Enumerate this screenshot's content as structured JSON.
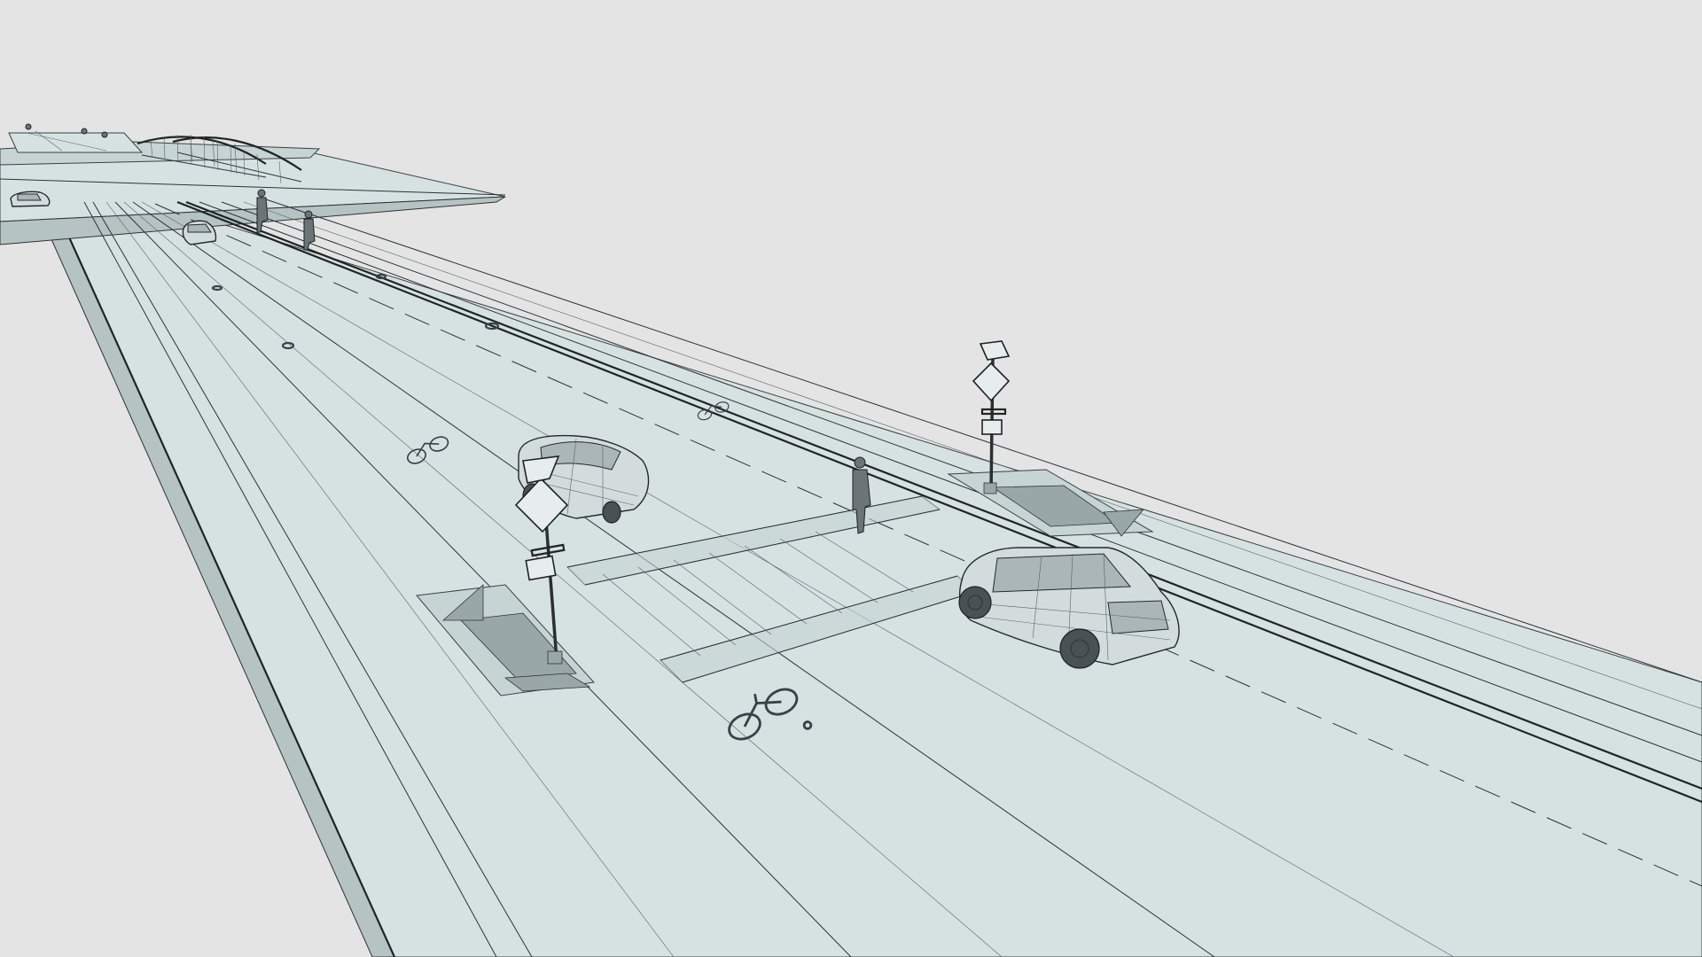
{
  "scene": {
    "background_color": "#e4e4e4",
    "ground_color": "#d6e2e2",
    "line_color": "#2d3236",
    "objects": {
      "cars": [
        "sedan-near-crosswalk",
        "suv-foreground",
        "car-distant-road",
        "car-far-left"
      ],
      "pedestrians": [
        "pedestrian-crosswalk",
        "pedestrian-bridge-1",
        "pedestrian-bridge-2"
      ],
      "signs": [
        "sign-pole-left",
        "sign-pole-right"
      ],
      "bike_lane_symbols": [
        "bike-symbol-foreground",
        "bike-symbol-mid",
        "bike-symbol-far"
      ]
    }
  }
}
